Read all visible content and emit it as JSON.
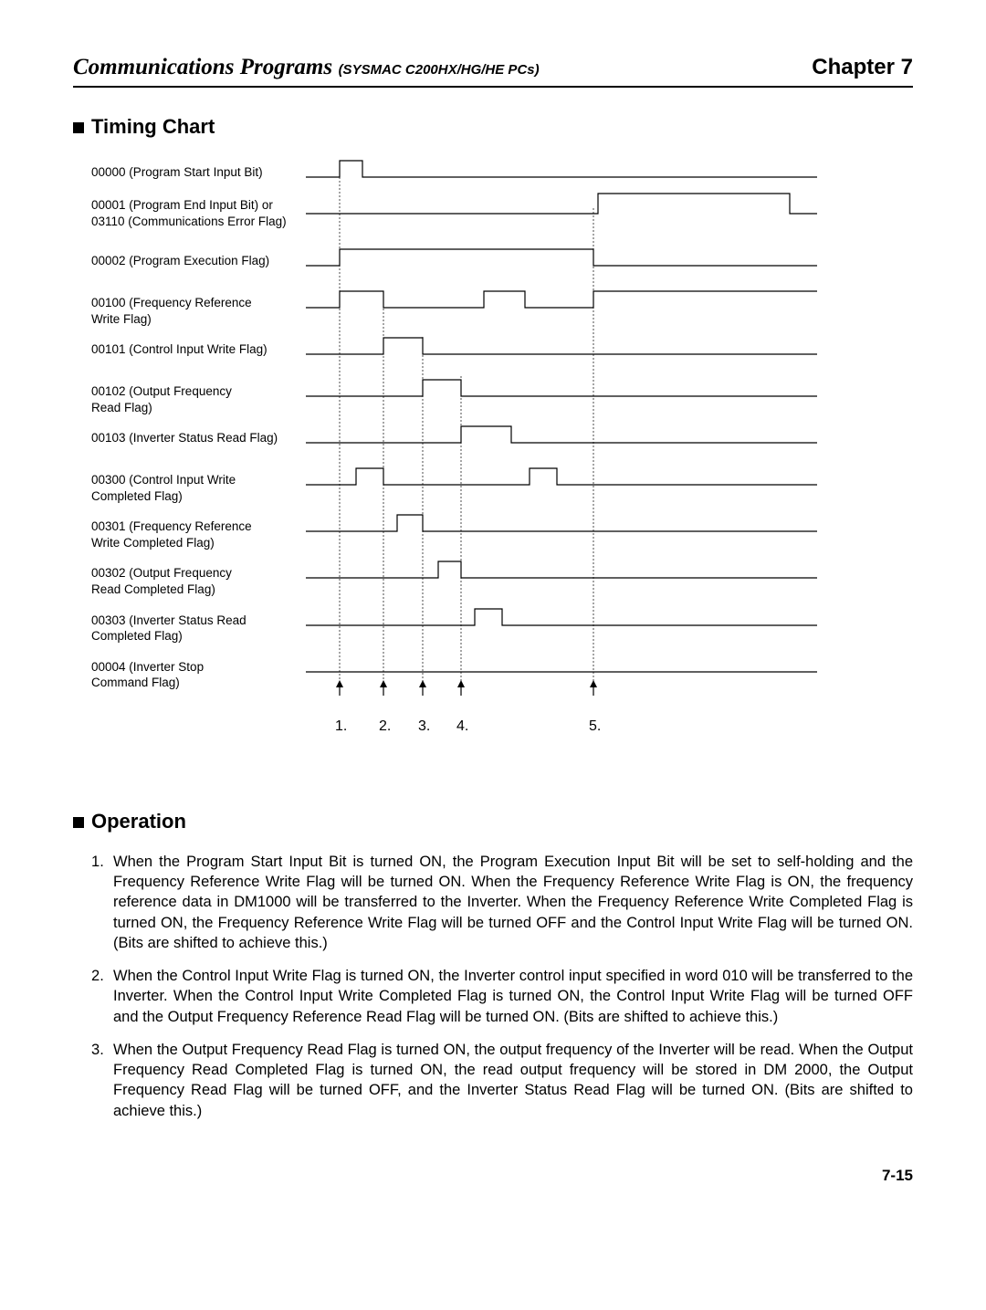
{
  "header": {
    "title_main": "Communications Programs",
    "title_sub": "(SYSMAC C200HX/HG/HE PCs)",
    "chapter": "Chapter 7"
  },
  "sections": {
    "timing_title": "Timing Chart",
    "operation_title": "Operation"
  },
  "signals": [
    "00000 (Program Start Input Bit)",
    "00001 (Program End Input Bit) or\n03110 (Communications Error Flag)",
    "00002 (Program Execution Flag)",
    "00100 (Frequency Reference\nWrite Flag)",
    "00101 (Control Input Write Flag)",
    "00102 (Output Frequency\nRead Flag)",
    "00103 (Inverter Status Read Flag)",
    "00300 (Control Input Write\nCompleted Flag)",
    "00301 (Frequency Reference\nWrite Completed Flag)",
    "00302 (Output Frequency\nRead Completed Flag)",
    "00303 (Inverter Status Read\nCompleted Flag)",
    "00004 (Inverter Stop\nCommand Flag)"
  ],
  "timeline_labels": [
    "1.",
    "2.",
    "3.",
    "4.",
    "5."
  ],
  "operation_items": [
    "When the Program Start Input Bit is turned ON, the Program Execution Input Bit will be set to self-holding and the Frequency Reference Write Flag will be turned ON. When the Frequency Reference Write Flag is ON, the frequency reference data in DM1000 will be transferred to the Inverter. When the Frequency Reference Write Completed Flag is turned ON, the Frequency Reference Write Flag will be turned OFF and the Control Input Write Flag will be turned ON. (Bits are shifted to achieve this.)",
    "When the Control Input Write Flag is turned ON, the Inverter control input specified in word 010 will be transferred to the Inverter. When the Control Input Write Completed Flag is turned ON, the Control Input Write Flag will be turned OFF and the Output Frequency Reference Read Flag will be turned ON. (Bits are shifted to achieve this.)",
    "When the Output Frequency Read Flag is turned ON, the output frequency of the Inverter will be read. When the Output Frequency Read Completed Flag is turned ON, the read output frequency will be stored in DM 2000, the Output Frequency Read Flag will be turned OFF, and the Inverter Status Read Flag will be turned ON. (Bits are shifted to achieve this.)"
  ],
  "page_number": "7-15"
}
